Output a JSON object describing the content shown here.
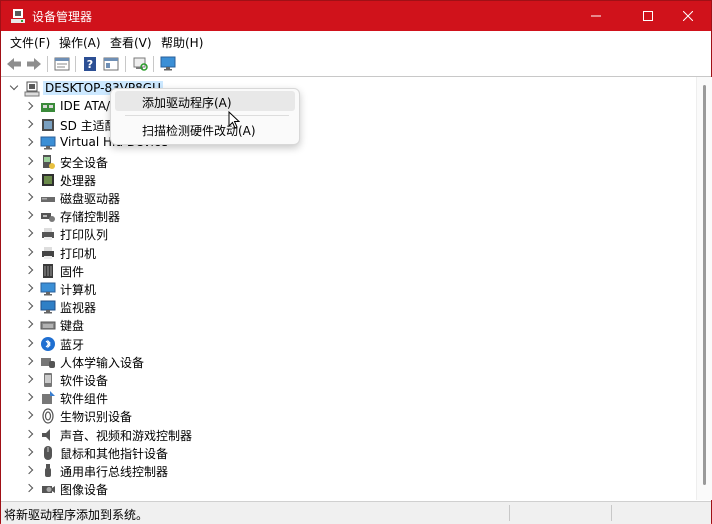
{
  "window": {
    "title": "设备管理器",
    "accent_color": "#d0121b",
    "controls": {
      "minimize": "minimize-icon",
      "maximize": "maximize-icon",
      "close": "close-icon"
    }
  },
  "menubar": {
    "items": [
      "文件(F)",
      "操作(A)",
      "查看(V)",
      "帮助(H)"
    ]
  },
  "toolbar": {
    "buttons": [
      "back-arrow-icon",
      "forward-arrow-icon",
      "properties-icon",
      "help-icon",
      "console-icon",
      "scan-hardware-icon",
      "monitor-icon"
    ]
  },
  "tree": {
    "root": {
      "label": "DESKTOP-83VP8GU",
      "expanded": true,
      "selected": true
    },
    "categories": [
      {
        "label": "IDE ATA/",
        "icon": "ide-controller-icon"
      },
      {
        "label": "SD 主适配",
        "icon": "sd-host-icon"
      },
      {
        "label": "Virtual Hid Device",
        "icon": "virtual-hid-icon"
      },
      {
        "label": "安全设备",
        "icon": "security-device-icon"
      },
      {
        "label": "处理器",
        "icon": "processor-icon"
      },
      {
        "label": "磁盘驱动器",
        "icon": "disk-drive-icon"
      },
      {
        "label": "存储控制器",
        "icon": "storage-controller-icon"
      },
      {
        "label": "打印队列",
        "icon": "print-queue-icon"
      },
      {
        "label": "打印机",
        "icon": "printer-icon"
      },
      {
        "label": "固件",
        "icon": "firmware-icon"
      },
      {
        "label": "计算机",
        "icon": "computer-icon"
      },
      {
        "label": "监视器",
        "icon": "monitor-icon"
      },
      {
        "label": "键盘",
        "icon": "keyboard-icon"
      },
      {
        "label": "蓝牙",
        "icon": "bluetooth-icon"
      },
      {
        "label": "人体学输入设备",
        "icon": "hid-icon"
      },
      {
        "label": "软件设备",
        "icon": "software-device-icon"
      },
      {
        "label": "软件组件",
        "icon": "software-component-icon"
      },
      {
        "label": "生物识别设备",
        "icon": "biometric-icon"
      },
      {
        "label": "声音、视频和游戏控制器",
        "icon": "audio-icon"
      },
      {
        "label": "鼠标和其他指针设备",
        "icon": "mouse-icon"
      },
      {
        "label": "通用串行总线控制器",
        "icon": "usb-icon"
      },
      {
        "label": "图像设备",
        "icon": "camera-icon"
      }
    ]
  },
  "context_menu": {
    "items": [
      {
        "label": "添加驱动程序(A)",
        "hovered": true
      },
      {
        "label": "扫描检测硬件改动(A)",
        "hovered": false
      }
    ]
  },
  "statusbar": {
    "text": "将新驱动程序添加到系统。"
  }
}
